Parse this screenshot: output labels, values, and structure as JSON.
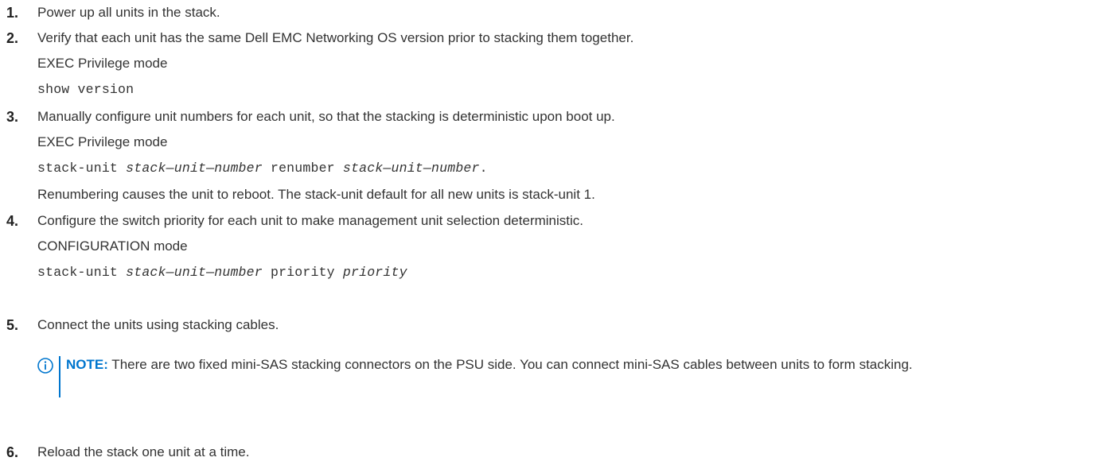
{
  "steps": [
    {
      "number": "1.",
      "text": "Power up all units in the stack."
    },
    {
      "number": "2.",
      "text": "Verify that each unit has the same Dell EMC Networking OS version prior to stacking them together.",
      "mode": "EXEC Privilege mode",
      "command": "show version"
    },
    {
      "number": "3.",
      "text": "Manually configure unit numbers for each unit, so that the stacking is deterministic upon boot up.",
      "mode": "EXEC Privilege mode",
      "command_parts": [
        "stack-unit ",
        "stack—unit—number",
        " renumber ",
        "stack—unit—number",
        "."
      ],
      "followup": "Renumbering causes the unit to reboot. The stack-unit default for all new units is stack-unit 1."
    },
    {
      "number": "4.",
      "text": "Configure the switch priority for each unit to make management unit selection deterministic.",
      "mode": "CONFIGURATION mode",
      "command_parts": [
        "stack-unit ",
        "stack—unit—number",
        " priority ",
        "priority"
      ]
    },
    {
      "number": "5.",
      "text": "Connect the units using stacking cables.",
      "note": {
        "label": "NOTE:",
        "text": " There are two fixed mini-SAS stacking connectors on the PSU side. You can connect mini-SAS cables between units to form stacking.",
        "icon": "info-icon",
        "accent_color": "#0076ce"
      }
    },
    {
      "number": "6.",
      "text": "Reload the stack one unit at a time."
    }
  ]
}
